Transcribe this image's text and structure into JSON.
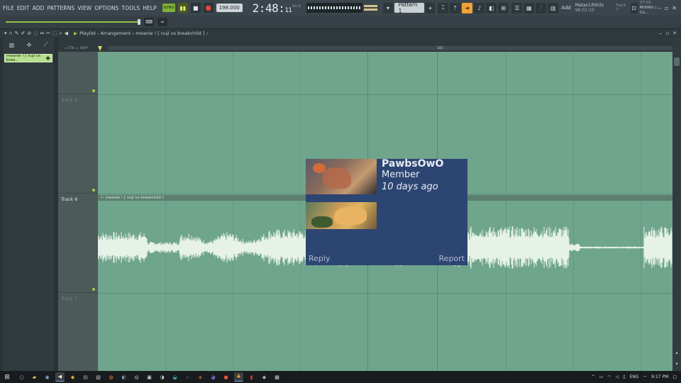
{
  "menu": [
    "FILE",
    "EDIT",
    "ADD",
    "PATTERNS",
    "VIEW",
    "OPTIONS",
    "TOOLS",
    "HELP"
  ],
  "transport": {
    "mode_label": "SONG",
    "play_symbol": "▮▮",
    "stop_symbol": "■",
    "record_symbol": "●",
    "tempo": "198.000",
    "time_main": "2:48",
    "time_sub": "11",
    "time_unit": "M:S:CS"
  },
  "pattern": {
    "selected": "Pattern 1",
    "add_label": "Add"
  },
  "hint_panel": {
    "title": "Matanl.ifshitz",
    "time": "96:01:10",
    "track": "Track 7"
  },
  "cpu_panel": {
    "line1": "07/18",
    "line2": "MIXING | Co..."
  },
  "playlist": {
    "title": "Playlist - Arrangement › meanie ! [ nuji vs breakchild ] ›",
    "clip_name": "meanie ! [ nuji vs brea...",
    "ruler_number": "183",
    "ruler_sub": "▸ CTRL ◂ · SNAP"
  },
  "tracks": [
    {
      "label": "Track 5"
    },
    {
      "label": "Track 6"
    },
    {
      "label": "Track 7"
    }
  ],
  "audio_clip": {
    "header": "⊢ meanie ! [ nuji vs breakchild ]"
  },
  "notification": {
    "name": "PawbsOwO",
    "role": "Member",
    "time": "10 days ago",
    "action_reply": "Reply",
    "action_report": "Report"
  },
  "taskbar": {
    "lang": "ENG",
    "clock": "9:17 PM"
  },
  "colors": {
    "grid": "#6fa48d",
    "waveform": "#e6f2e8",
    "accent_green": "#9bd04a",
    "active_tool": "#f2a23a",
    "overlay_bg": "#2d4572"
  },
  "icons": {
    "snap": "magnet-icon",
    "draw": "pencil-icon",
    "paint": "brush-icon",
    "delete": "eraser-icon",
    "mute": "mute-icon",
    "slip": "slip-icon",
    "slice": "slice-icon",
    "select": "select-icon",
    "zoom": "zoom-icon",
    "playback": "speaker-icon"
  }
}
